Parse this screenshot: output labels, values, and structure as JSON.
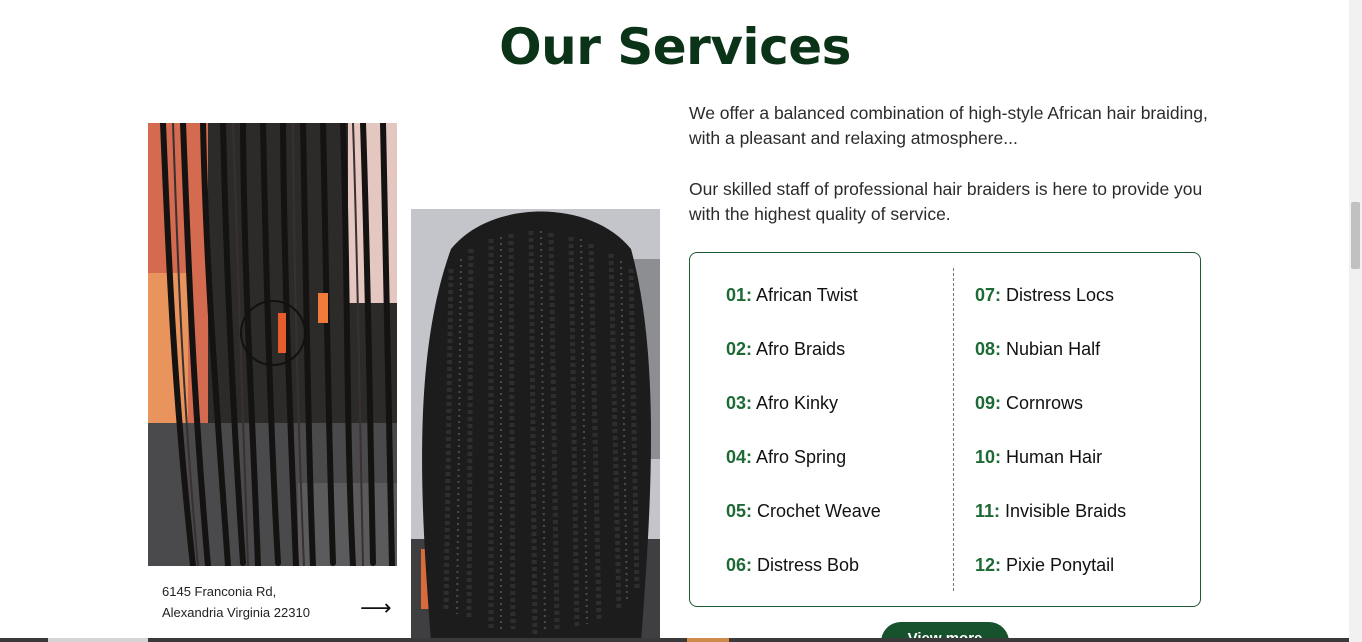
{
  "section": {
    "title": "Our Services"
  },
  "intro": {
    "paragraph_1": "We offer a balanced combination of high-style African hair braiding, with a pleasant and relaxing atmosphere...",
    "paragraph_2": "Our skilled staff of professional hair braiders is here to provide you with the highest quality of service."
  },
  "address": {
    "line_1": "6145 Franconia Rd,",
    "line_2": "Alexandria Virginia 22310",
    "arrow_icon": "arrow-right-icon"
  },
  "services": {
    "left": [
      {
        "num": "01:",
        "name": "African Twist"
      },
      {
        "num": "02:",
        "name": "Afro Braids"
      },
      {
        "num": "03:",
        "name": "Afro Kinky"
      },
      {
        "num": "04:",
        "name": "Afro Spring"
      },
      {
        "num": "05:",
        "name": "Crochet Weave"
      },
      {
        "num": "06:",
        "name": "Distress Bob"
      }
    ],
    "right": [
      {
        "num": "07:",
        "name": "Distress Locs"
      },
      {
        "num": "08:",
        "name": "Nubian Half"
      },
      {
        "num": "09:",
        "name": "Cornrows"
      },
      {
        "num": "10:",
        "name": "Human Hair"
      },
      {
        "num": "11:",
        "name": "Invisible Braids"
      },
      {
        "num": "12:",
        "name": "Pixie Ponytail"
      }
    ]
  },
  "cta": {
    "view_more_label": "View more"
  },
  "colors": {
    "title_green": "#0b3318",
    "accent_green": "#1d6a35",
    "button_green": "#16532c",
    "border_green": "#1e5a33"
  }
}
